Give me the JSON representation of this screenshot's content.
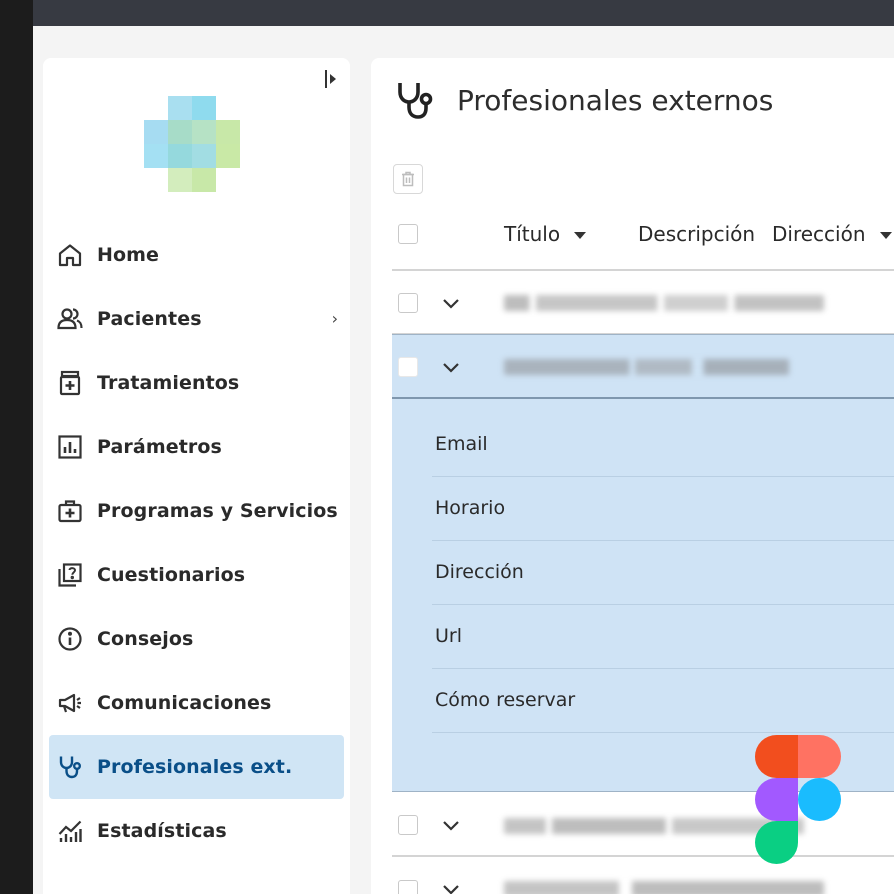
{
  "page": {
    "title": "Profesionales externos"
  },
  "sidebar": {
    "items": [
      {
        "label": "Home",
        "icon": "home-icon",
        "active": false
      },
      {
        "label": "Pacientes",
        "icon": "users-icon",
        "active": false,
        "has_submenu": true
      },
      {
        "label": "Tratamientos",
        "icon": "medicine-icon",
        "active": false
      },
      {
        "label": "Parámetros",
        "icon": "chart-box-icon",
        "active": false
      },
      {
        "label": "Programas y Servicios",
        "icon": "medical-bag-icon",
        "active": false
      },
      {
        "label": "Cuestionarios",
        "icon": "quiz-icon",
        "active": false
      },
      {
        "label": "Consejos",
        "icon": "info-icon",
        "active": false
      },
      {
        "label": "Comunicaciones",
        "icon": "megaphone-icon",
        "active": false
      },
      {
        "label": "Profesionales ext.",
        "icon": "stethoscope-icon",
        "active": true
      },
      {
        "label": "Estadísticas",
        "icon": "stats-icon",
        "active": false
      }
    ],
    "submenu_glyph": "›"
  },
  "table": {
    "columns": [
      "Título",
      "Descripción",
      "Dirección"
    ],
    "expanded_fields": [
      "Email",
      "Horario",
      "Dirección",
      "Url",
      "Cómo reservar"
    ]
  },
  "colors": {
    "active_bg": "#d0e5f5",
    "active_text": "#0a4f88",
    "expanded_bg": "#cfe3f5",
    "topbar": "#373a42"
  }
}
